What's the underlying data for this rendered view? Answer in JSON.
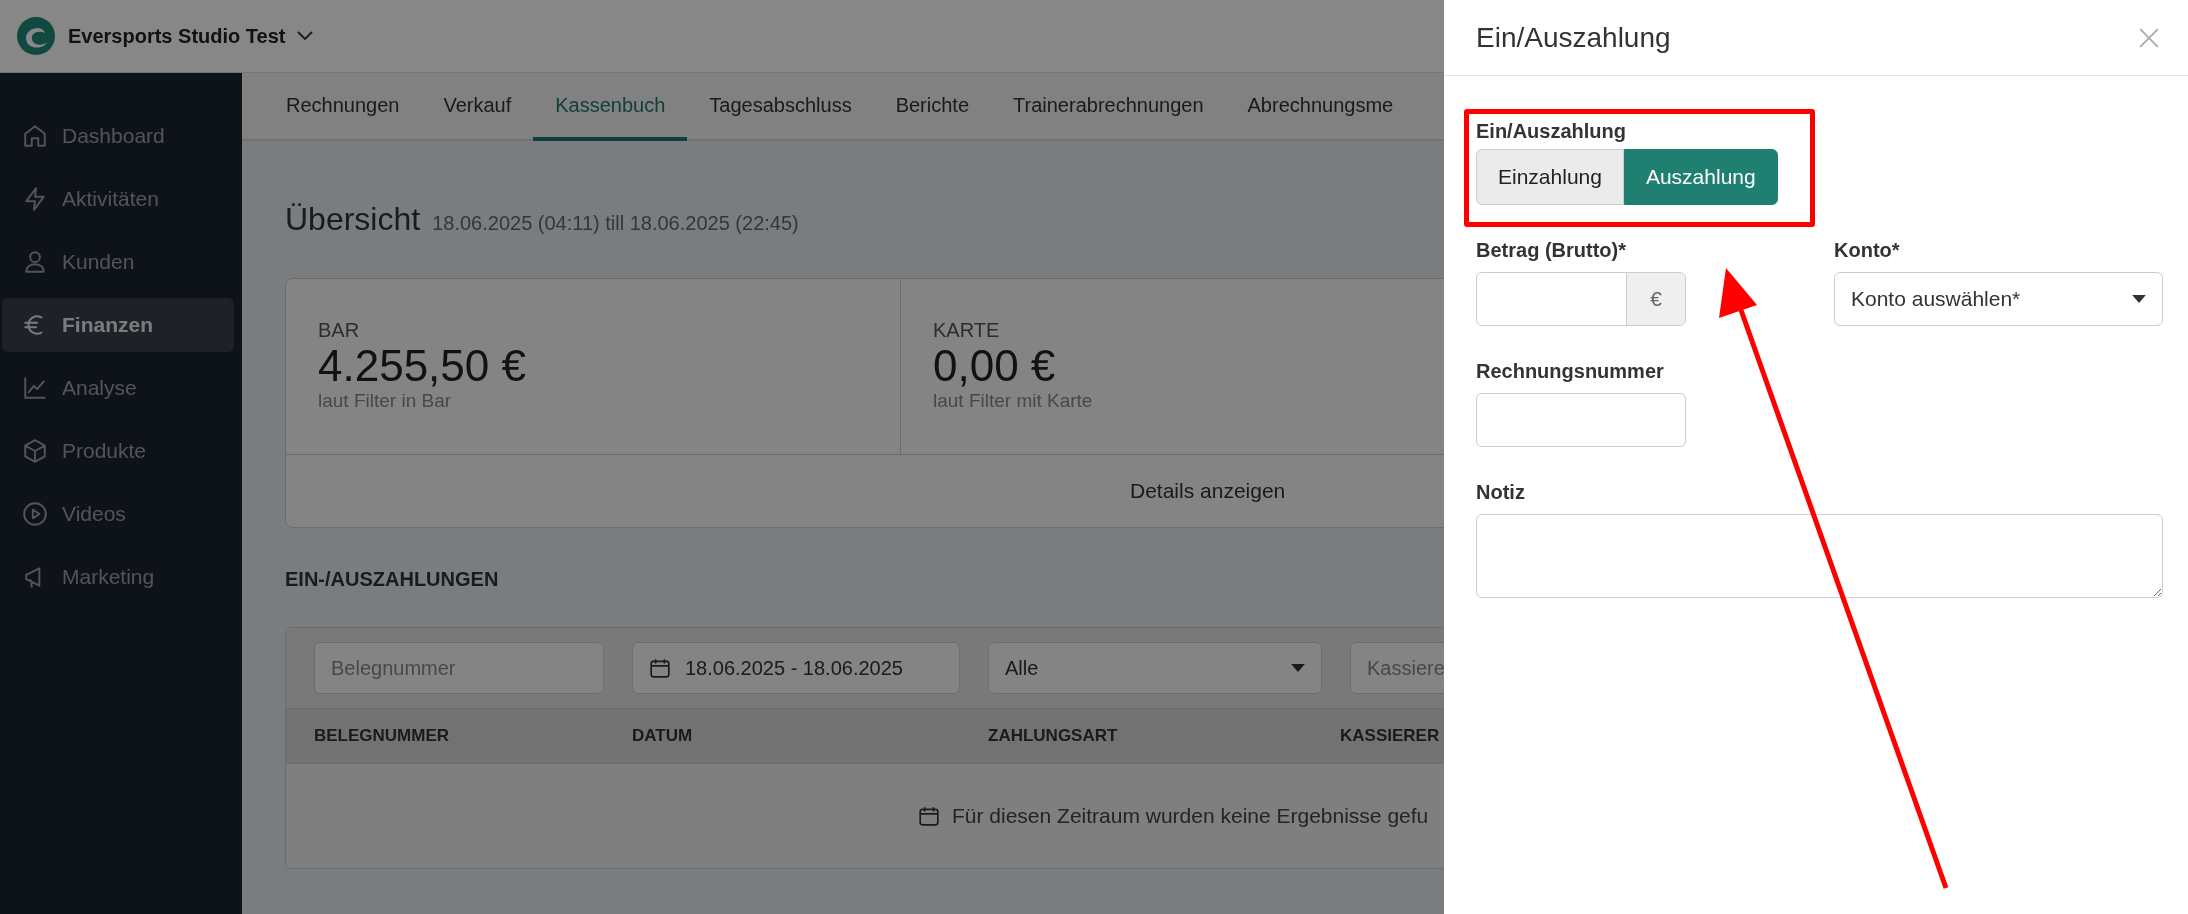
{
  "header": {
    "studio_name": "Eversports Studio Test"
  },
  "sidebar": {
    "items": [
      {
        "label": "Dashboard",
        "selected": false
      },
      {
        "label": "Aktivitäten",
        "selected": false
      },
      {
        "label": "Kunden",
        "selected": false
      },
      {
        "label": "Finanzen",
        "selected": true
      },
      {
        "label": "Analyse",
        "selected": false
      },
      {
        "label": "Produkte",
        "selected": false
      },
      {
        "label": "Videos",
        "selected": false
      },
      {
        "label": "Marketing",
        "selected": false
      }
    ]
  },
  "tabs": [
    {
      "label": "Rechnungen",
      "selected": false
    },
    {
      "label": "Verkauf",
      "selected": false
    },
    {
      "label": "Kassenbuch",
      "selected": true
    },
    {
      "label": "Tagesabschluss",
      "selected": false
    },
    {
      "label": "Berichte",
      "selected": false
    },
    {
      "label": "Trainerabrechnungen",
      "selected": false
    },
    {
      "label": "Abrechnungsme",
      "selected": false
    }
  ],
  "overview": {
    "title": "Übersicht",
    "range": "18.06.2025 (04:11) till 18.06.2025 (22:45)",
    "cards": [
      {
        "label": "BAR",
        "amount": "4.255,50 €",
        "note": "laut Filter in Bar"
      },
      {
        "label": "KARTE",
        "amount": "0,00 €",
        "note": "laut Filter mit Karte"
      }
    ],
    "details_link": "Details anzeigen"
  },
  "transactions": {
    "title": "EIN-/AUSZAHLUNGEN",
    "filters": {
      "receipt_placeholder": "Belegnummer",
      "date_range": "18.06.2025 - 18.06.2025",
      "payment_type": "Alle",
      "cashier_placeholder": "Kassiere"
    },
    "columns": [
      "BELEGNUMMER",
      "DATUM",
      "ZAHLUNGSART",
      "KASSIERER"
    ],
    "empty_message": "Für diesen Zeitraum wurden keine Ergebnisse gefu"
  },
  "drawer": {
    "title": "Ein/Auszahlung",
    "type_label": "Ein/Auszahlung",
    "type_options": [
      {
        "label": "Einzahlung",
        "selected": false
      },
      {
        "label": "Auszahlung",
        "selected": true
      }
    ],
    "amount_label": "Betrag (Brutto)*",
    "currency": "€",
    "account_label": "Konto*",
    "account_placeholder": "Konto auswählen*",
    "invoice_label": "Rechnungsnummer",
    "note_label": "Notiz"
  }
}
